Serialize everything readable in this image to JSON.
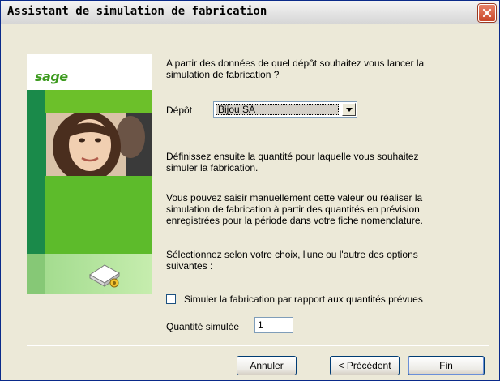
{
  "window": {
    "title": "Assistant de simulation de fabrication"
  },
  "intro": {
    "line1": "A partir des données de quel dépôt souhaitez vous lancer la",
    "line2": "simulation de fabrication ?"
  },
  "depot": {
    "label": "Dépôt",
    "value": "Bijou SA"
  },
  "quantity_text": {
    "line1": "Définissez ensuite la quantité pour laquelle vous souhaitez",
    "line2": "simuler la fabrication."
  },
  "manual_text": {
    "line1": "Vous pouvez saisir manuellement cette valeur ou réaliser la",
    "line2": "simulation de fabrication à partir des quantités en prévision",
    "line3": "enregistrées pour la période dans votre fiche nomenclature."
  },
  "select_text": {
    "line1": "Sélectionnez selon votre choix, l'une ou l'autre des options",
    "line2": "suivantes :"
  },
  "checkbox": {
    "label": "Simuler la fabrication par rapport aux quantités prévues",
    "checked": false
  },
  "simulated_qty": {
    "label": "Quantité simulée",
    "value": "1"
  },
  "buttons": {
    "cancel_first": "A",
    "cancel_rest": "nnuler",
    "prev_lead": "< ",
    "prev_first": "P",
    "prev_rest": "récédent",
    "finish_first": "F",
    "finish_rest": "in"
  },
  "logo": {
    "text": "sage"
  },
  "colors": {
    "accent_green": "#5dbb2b",
    "dark_green": "#1a8a4a",
    "close_red": "#C9462A"
  }
}
